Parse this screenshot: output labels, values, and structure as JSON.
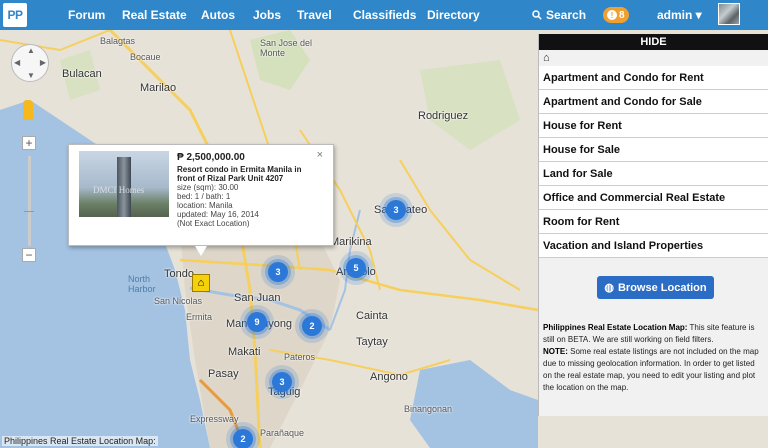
{
  "navbar": {
    "logo": "PP",
    "items": [
      "Forum",
      "Real Estate",
      "Autos",
      "Jobs",
      "Travel",
      "Classifieds",
      "Directory"
    ],
    "search_label": "Search",
    "notification_count": "8",
    "user": "admin"
  },
  "map": {
    "labels": {
      "balagtas": "Balagtas",
      "bocaue": "Bocaue",
      "san_jose_del_monte": "San Jose del\nMonte",
      "bulacan": "Bulacan",
      "marilao": "Marilao",
      "rodriguez": "Rodriguez",
      "tondo": "Tondo",
      "north_harbor": "North\nHarbor",
      "san_nicolas": "San Nicolas",
      "san_juan": "San Juan",
      "ermita": "Ermita",
      "mandaluyong": "Mandaluyong",
      "cainta": "Cainta",
      "taytay": "Taytay",
      "makati": "Makati",
      "pateros": "Pateros",
      "pasay": "Pasay",
      "taguig": "Taguig",
      "angono": "Angono",
      "binangonan": "Binangonan",
      "san_mateo": "San Mateo",
      "marikina": "Marikina",
      "antipolo": "Antipolo",
      "paranaque": "Parañaque",
      "expressway": "Expressway"
    },
    "clusters": [
      "3",
      "3",
      "5",
      "9",
      "2",
      "3",
      "2"
    ],
    "attribution": "Philippines Real Estate Location Map:"
  },
  "infowindow": {
    "price": "₱ 2,500,000.00",
    "title": "Resort condo in Ermita Manila in front of Rizal Park Unit 4207",
    "size": "size (sqm): 30.00",
    "bed_bath": "bed: 1 / bath: 1",
    "location": "location: Manila",
    "updated": "updated: May 16, 2014",
    "exactness": "(Not Exact Location)",
    "watermark": "DMCI Homes",
    "close": "×"
  },
  "panel": {
    "hide": "HIDE",
    "categories": [
      "Apartment and Condo for Rent",
      "Apartment and Condo for Sale",
      "House for Rent",
      "House for Sale",
      "Land for Sale",
      "Office and Commercial Real Estate",
      "Room for Rent",
      "Vacation and Island Properties"
    ],
    "browse_button": "Browse Location",
    "note_title": "Philippines Real Estate Location Map:",
    "note_beta": " This site feature is still on BETA. We are still working on field filters.",
    "note_label": "NOTE:",
    "note_body": " Some real estate listings are not included on the map due to missing geolocation information. In order to get listed on the real estate map, you need to edit your listing and plot the location on the map."
  },
  "colors": {
    "navbar": "#2f86c9",
    "badge": "#f0a030",
    "cluster": "#2b78d8",
    "button": "#2b6cc4"
  }
}
